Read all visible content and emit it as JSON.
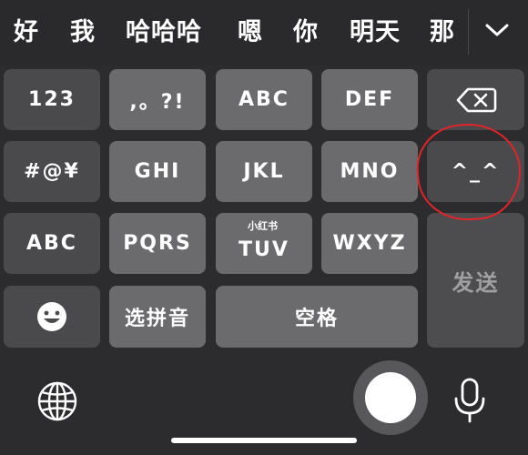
{
  "candidates": [
    "好",
    "我",
    "哈哈哈",
    "嗯",
    "你",
    "明天",
    "那"
  ],
  "keys": {
    "numbers": "123",
    "punct": ",。?!",
    "abc_top": "ABC",
    "def": "DEF",
    "symbols": "#@¥",
    "ghi": "GHI",
    "jkl": "JKL",
    "mno": "MNO",
    "emoticon": "^_^",
    "abc_switch": "ABC",
    "pqrs": "PQRS",
    "tuv": "TUV",
    "wxyz": "WXYZ",
    "send": "发送",
    "pinyin": "选拼音",
    "space": "空格"
  },
  "watermark": "小红书",
  "icons": {
    "collapse": "chevron-down-icon",
    "delete": "backspace-icon",
    "emoji": "smiley-face-icon",
    "globe": "globe-icon",
    "mic": "microphone-icon",
    "assistive": "assistive-touch-icon"
  },
  "colors": {
    "annotation_circle": "#e0242a",
    "keyboard_bg": "#2c2c2e",
    "key_dark": "#4a4a4d",
    "key_light": "#6b6b6e"
  }
}
